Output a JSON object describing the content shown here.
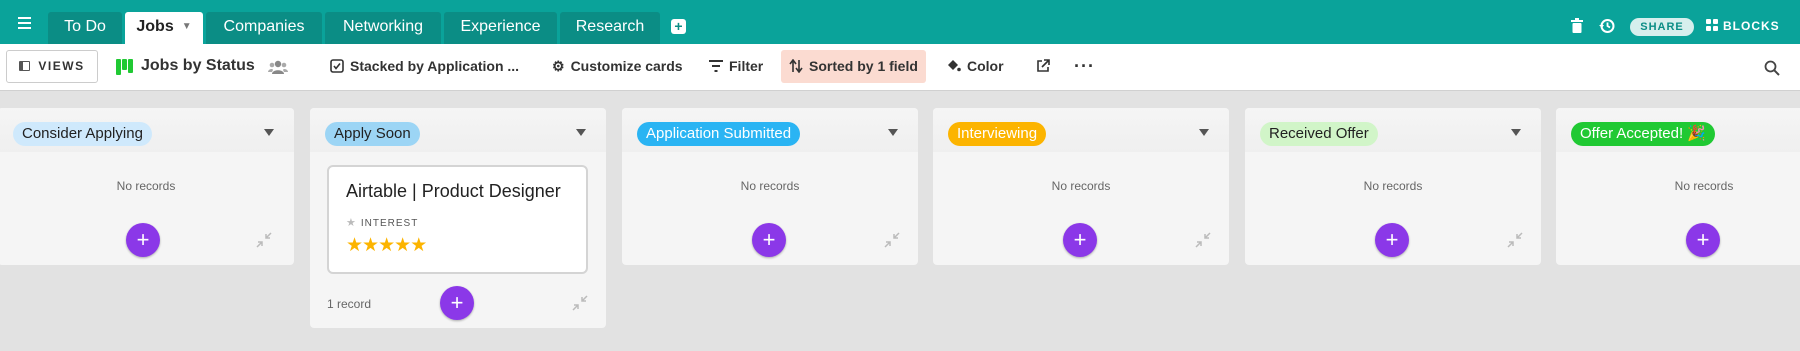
{
  "tabs": [
    {
      "label": "To Do",
      "active": false
    },
    {
      "label": "Jobs",
      "active": true
    },
    {
      "label": "Companies",
      "active": false
    },
    {
      "label": "Networking",
      "active": false
    },
    {
      "label": "Experience",
      "active": false
    },
    {
      "label": "Research",
      "active": false
    }
  ],
  "header": {
    "share_label": "SHARE",
    "blocks_label": "BLOCKS",
    "icons": [
      "trash-icon",
      "history-icon",
      "grid-icon"
    ]
  },
  "toolbar": {
    "views_label": "VIEWS",
    "view_name": "Jobs by Status",
    "stacked_label": "Stacked by Application ...",
    "customize_label": "Customize cards",
    "filter_label": "Filter",
    "sort_label": "Sorted by 1 field",
    "color_label": "Color"
  },
  "stacks": [
    {
      "label": "Consider Applying",
      "color": "#cfe9fc",
      "empty_text": "No records"
    },
    {
      "label": "Apply Soon",
      "color": "#9cd5f5",
      "record_count": "1 record"
    },
    {
      "label": "Application Submitted",
      "color": "#2ab4f3",
      "empty_text": "No records"
    },
    {
      "label": "Interviewing",
      "color": "#fcb400",
      "empty_text": "No records"
    },
    {
      "label": "Received Offer",
      "color": "#d1f5c8",
      "empty_text": "No records"
    },
    {
      "label": "Offer Accepted! 🎉",
      "color": "#20c933",
      "empty_text": "No records"
    }
  ],
  "card": {
    "title": "Airtable | Product Designer",
    "field_label": "INTEREST",
    "rating": 5,
    "rating_max": 5
  },
  "colors": {
    "teal": "#0aa39a",
    "accent": "#8b38e8",
    "sort_bg": "#fbdbd1"
  }
}
